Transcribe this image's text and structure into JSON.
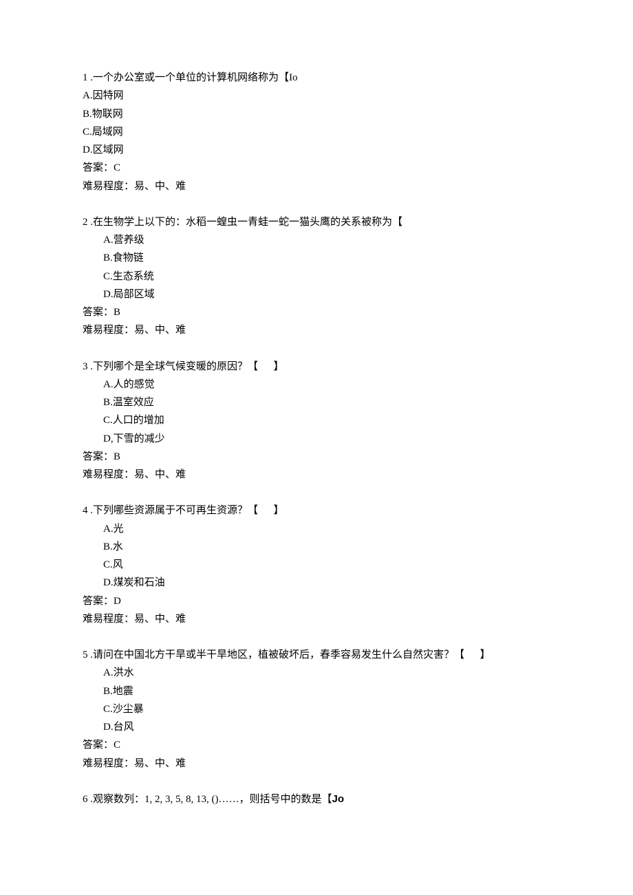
{
  "questions": [
    {
      "number": "1",
      "stem_prefix": " .一个办公室或一个单位的计算机网络称为【Io",
      "options": [
        "A.因特网",
        "B.物联网",
        "C.局域网",
        "D.区域网"
      ],
      "options_indented": false,
      "answer_line": "答案：C",
      "difficulty_line": "难易程度：易、中、难"
    },
    {
      "number": "2",
      "stem_prefix": " .在生物学上以下的：水稻一蝗虫一青蛙一蛇一猫头鹰的关系被称为【",
      "options": [
        "A.营养级",
        "B.食物链",
        "C.生态系统",
        "D.局部区域"
      ],
      "options_indented": true,
      "answer_line": "答案：B",
      "difficulty_line": "难易程度：易、中、难"
    },
    {
      "number": "3",
      "stem_prefix": " .下列哪个是全球气候变暖的原因？【      】",
      "options": [
        "A.人的感觉",
        "B.温室效应",
        "C.人口的增加",
        "D,下雪的减少"
      ],
      "options_indented": true,
      "answer_line": "答案：B",
      "difficulty_line": "难易程度：易、中、难"
    },
    {
      "number": "4",
      "stem_prefix": " .下列哪些资源属于不可再生资源？【      】",
      "options": [
        "A.光",
        "B.水",
        "C.风",
        "D.煤炭和石油"
      ],
      "options_indented": true,
      "answer_line": "答案：D",
      "difficulty_line": "难易程度：易、中、难"
    },
    {
      "number": "5",
      "stem_prefix": " .请问在中国北方干旱或半干旱地区，植被破坏后，春季容易发生什么自然灾害？【      】",
      "options": [
        "A.洪水",
        "B.地震",
        "C.沙尘暴",
        "D.台风"
      ],
      "options_indented": true,
      "answer_line": "答案：C",
      "difficulty_line": "难易程度：易、中、难"
    }
  ],
  "trailing": {
    "number": "6",
    "text_before": " .观察数列：1, 2, 3, 5, 8, 13, ()……，则括号中的数是【",
    "bold": "Jo",
    "text_after": ""
  }
}
